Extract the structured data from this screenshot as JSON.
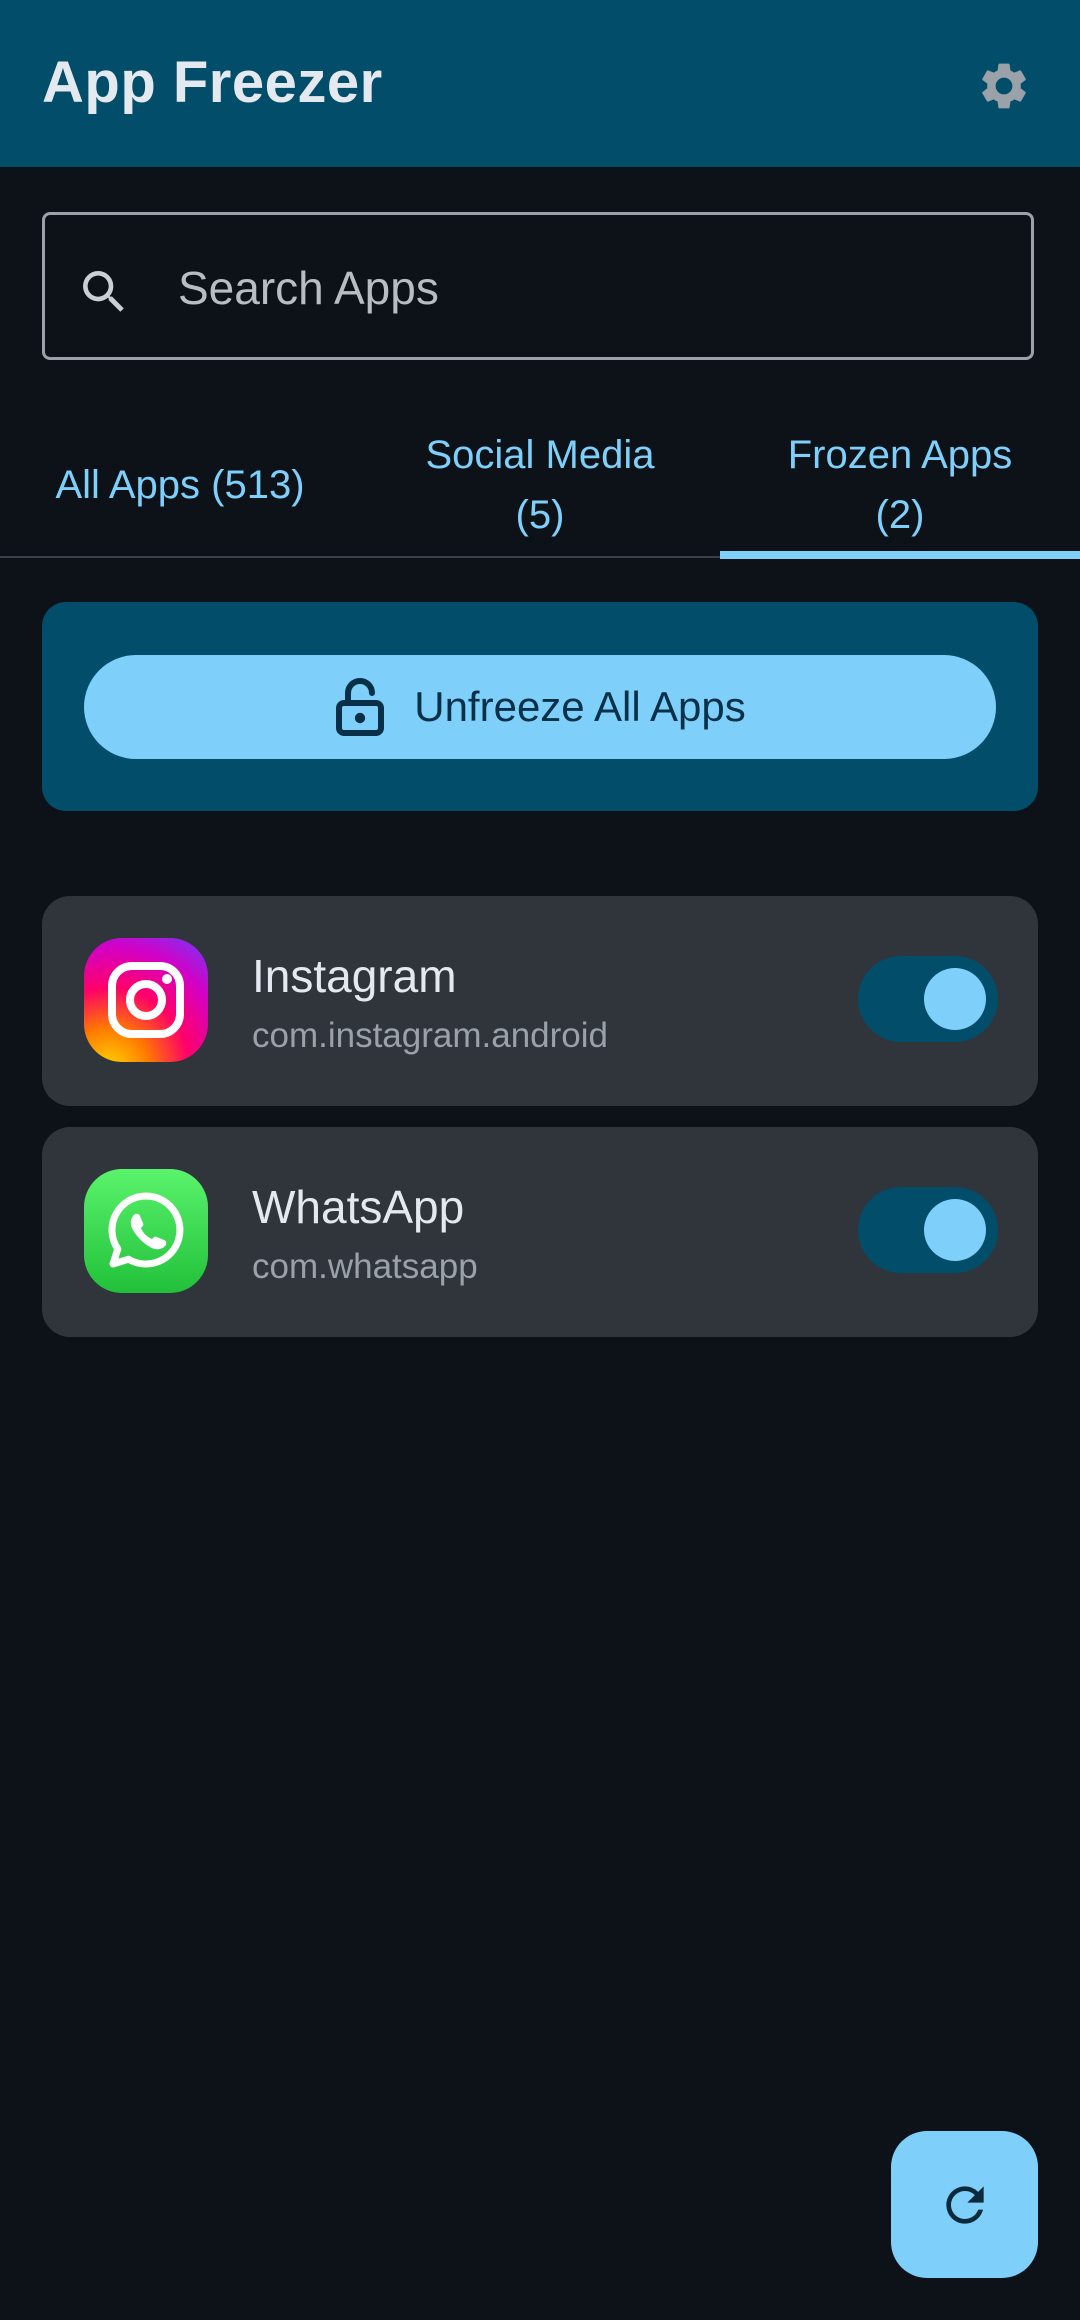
{
  "app_bar": {
    "title": "App Freezer",
    "settings_icon": "gear-icon"
  },
  "search": {
    "placeholder": "Search Apps",
    "value": "",
    "icon": "search-icon"
  },
  "tabs": [
    {
      "line1": "All Apps (513)",
      "line2": "",
      "selected": false
    },
    {
      "line1": "Social Media",
      "line2": "(5)",
      "selected": false
    },
    {
      "line1": "Frozen Apps",
      "line2": "(2)",
      "selected": true
    }
  ],
  "banner": {
    "button_label": "Unfreeze All Apps",
    "button_icon": "lock-open-icon"
  },
  "apps": [
    {
      "name": "Instagram",
      "package": "com.instagram.android",
      "icon": "instagram-icon",
      "frozen": true
    },
    {
      "name": "WhatsApp",
      "package": "com.whatsapp",
      "icon": "whatsapp-icon",
      "frozen": true
    }
  ],
  "fab": {
    "icon": "refresh-icon"
  },
  "colors": {
    "background": "#0c1218",
    "app_bar": "#024d6a",
    "accent": "#7ecff9",
    "card": "#30353c",
    "text_primary": "#e4e9ef",
    "text_secondary": "#9aa1a8"
  }
}
